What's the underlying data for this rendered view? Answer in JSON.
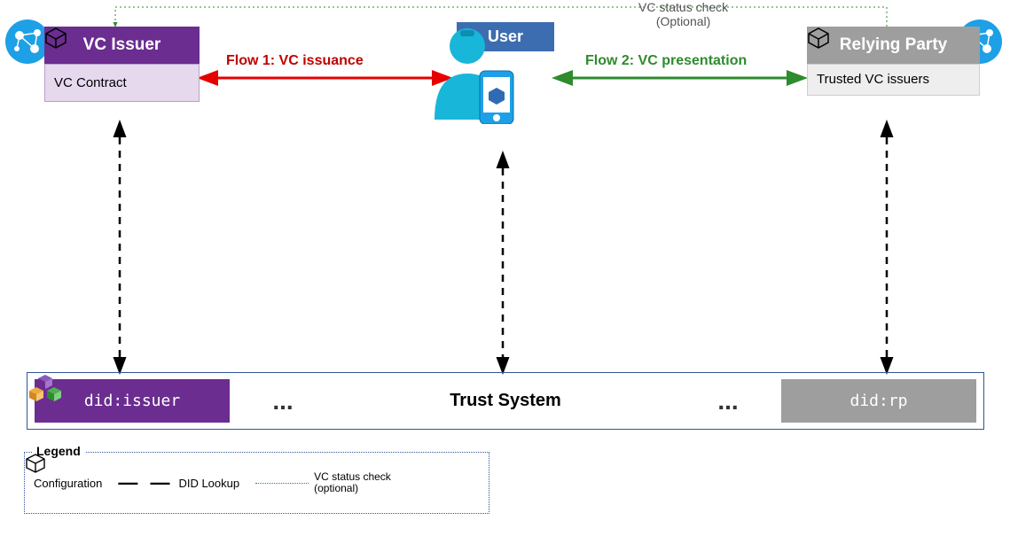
{
  "vc_issuer": {
    "title": "VC Issuer",
    "config": "VC Contract"
  },
  "relying": {
    "title": "Relying Party",
    "config": "Trusted VC issuers"
  },
  "user": {
    "label": "User"
  },
  "flow1": "Flow 1: VC  issuance",
  "flow2": "Flow 2: VC presentation",
  "status_check": {
    "line1": "VC status check",
    "line2": "(Optional)"
  },
  "trust": {
    "did_issuer": "did:issuer",
    "did_rp": "did:rp",
    "title": "Trust System",
    "dots": "..."
  },
  "legend": {
    "title": "Legend",
    "config": "Configuration",
    "did_lookup": "DID Lookup",
    "status": "VC status check\n(optional)"
  }
}
